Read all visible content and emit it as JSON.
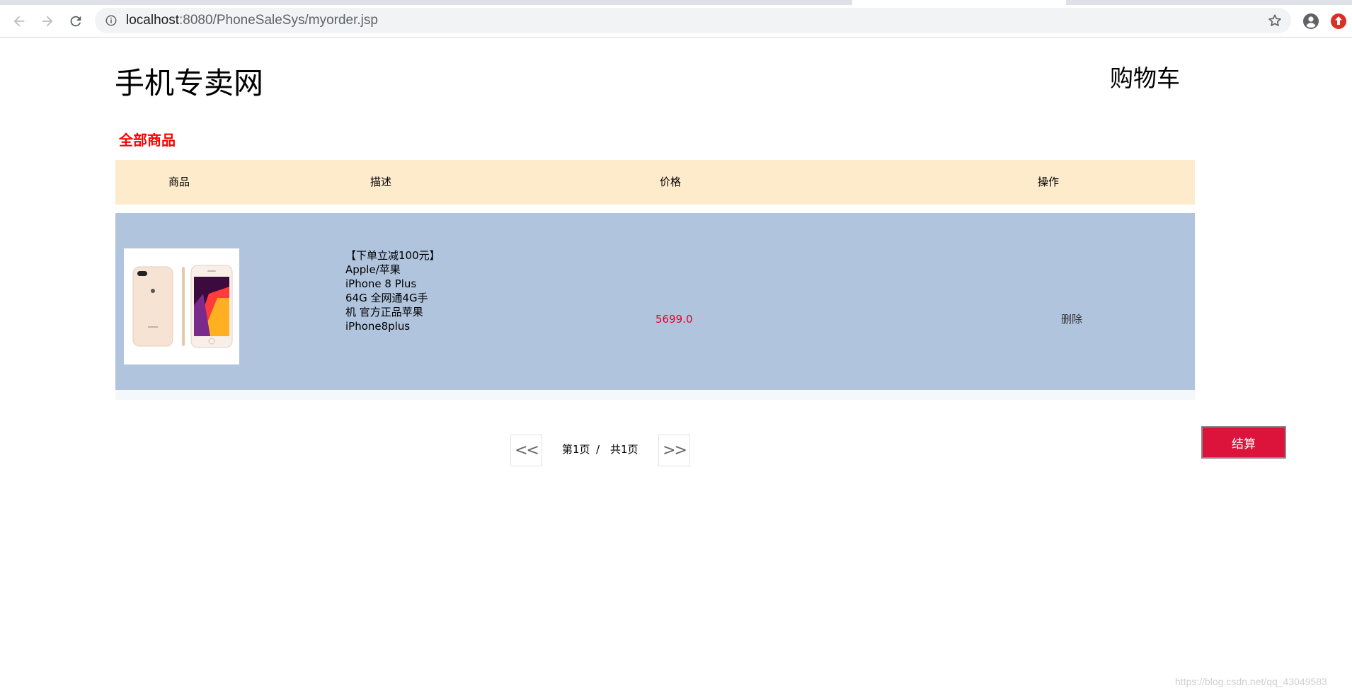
{
  "browser": {
    "url_host": "localhost",
    "url_rest": ":8080/PhoneSaleSys/myorder.jsp"
  },
  "site": {
    "title": "手机专卖网",
    "cart_link": "购物车"
  },
  "section": {
    "title": "全部商品"
  },
  "table": {
    "headers": [
      "商品",
      "描述",
      "价格",
      "操作"
    ],
    "rows": [
      {
        "description": "【下单立减100元】Apple/苹果 iPhone 8 Plus 64G 全网通4G手机 官方正品苹果 iPhone8plus",
        "price": "5699.0",
        "action": "删除"
      }
    ]
  },
  "pagination": {
    "prev": "<<",
    "current": "第1页",
    "separator": "/",
    "total": "共1页",
    "next": ">>"
  },
  "checkout_button": "结算",
  "watermark": "https://blog.csdn.net/qq_43049583",
  "colors": {
    "header_bg": "#fdebcc",
    "row_bg": "#b0c4de",
    "accent_red": "#dc143c",
    "section_red": "#ff0000",
    "price_red": "#e4002b"
  }
}
